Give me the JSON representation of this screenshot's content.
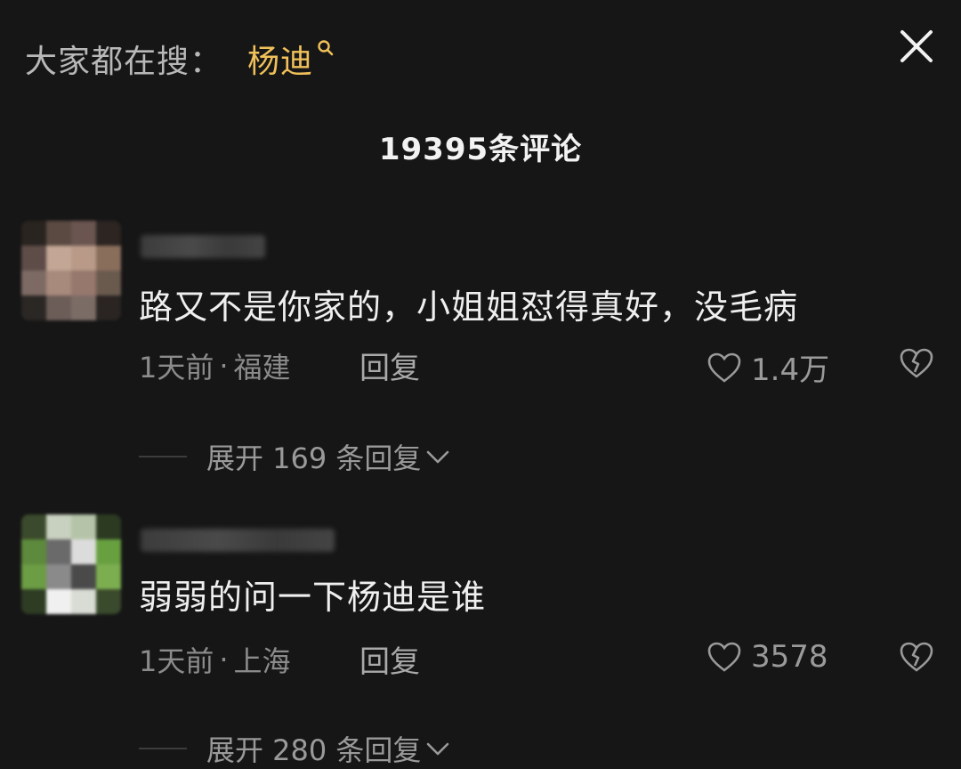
{
  "header": {
    "search_prefix": "大家都在搜：",
    "search_keyword": "杨迪",
    "search_keyword_icon": "search-icon",
    "close_icon": "close-icon",
    "keyword_color": "#f0c15a"
  },
  "comment_count_label": "19395条评论",
  "comments": [
    {
      "text": "路又不是你家的，小姐姐怼得真好，没毛病",
      "time": "1天前",
      "separator": "·",
      "location": "福建",
      "reply_label": "回复",
      "likes": "1.4万",
      "expand_label": "展开 169 条回复"
    },
    {
      "text": "弱弱的问一下杨迪是谁",
      "time": "1天前",
      "separator": "·",
      "location": "上海",
      "reply_label": "回复",
      "likes": "3578",
      "expand_label": "展开 280 条回复"
    }
  ]
}
